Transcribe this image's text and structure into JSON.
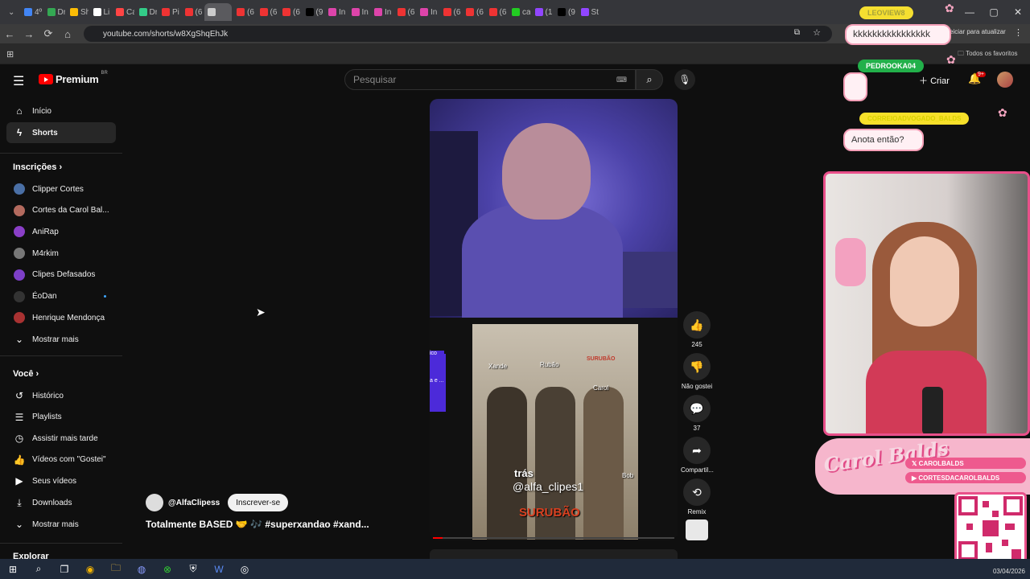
{
  "browser": {
    "tabs": [
      "4º",
      "Dr",
      "Sh",
      "Li",
      "Ca",
      "Dr",
      "Pi",
      "(6",
      "",
      "(6",
      "(6",
      "(6",
      "(9",
      "In",
      "In",
      "In",
      "(6",
      "In",
      "(6",
      "(6",
      "(6",
      "ca",
      "(1",
      "(9",
      "St"
    ],
    "url": "youtube.com/shorts/w8XgShqEhJk",
    "update_text": "eiciar para atualizar",
    "favorites_folder": "Todos os favoritos"
  },
  "youtube": {
    "logo": "Premium",
    "region": "BR",
    "search_placeholder": "Pesquisar",
    "create_label": "Criar",
    "notif_badge": "9+"
  },
  "sidebar": {
    "top": [
      {
        "label": "Início",
        "icon": "home-icon"
      },
      {
        "label": "Shorts",
        "icon": "shorts-icon",
        "selected": true
      }
    ],
    "subscriptions_title": "Inscrições",
    "subscriptions": [
      {
        "label": "Clipper Cortes",
        "color": "#4a6fa5"
      },
      {
        "label": "Cortes da Carol Bal...",
        "color": "#b36a5e"
      },
      {
        "label": "AniRap",
        "color": "#8a3fc7"
      },
      {
        "label": "M4rkim",
        "color": "#777777"
      },
      {
        "label": "Clipes Defasados",
        "color": "#7d3fc7"
      },
      {
        "label": "ÉoDan",
        "color": "#333333",
        "live": true
      },
      {
        "label": "Henrique Mendonça",
        "color": "#a83232"
      }
    ],
    "more_subs": "Mostrar mais",
    "you_title": "Você",
    "you_items": [
      {
        "label": "Histórico",
        "icon": "history-icon"
      },
      {
        "label": "Playlists",
        "icon": "playlists-icon"
      },
      {
        "label": "Assistir mais tarde",
        "icon": "clock-icon"
      },
      {
        "label": "Vídeos com \"Gostei\"",
        "icon": "like-icon"
      },
      {
        "label": "Seus vídeos",
        "icon": "video-icon"
      },
      {
        "label": "Downloads",
        "icon": "download-icon"
      }
    ],
    "more_you": "Mostrar mais",
    "explore_title": "Explorar"
  },
  "short": {
    "channel": "@AlfaClipess",
    "subscribe": "Inscrever-se",
    "title": "Totalmente BASED 🤝 🎶 #superxandao #xand...",
    "overlay_trash": "trás",
    "overlay_handle": "@alfa_clipes1",
    "overlay_logo": "SURUBÃO",
    "overlay_corner": "SURUBÃO",
    "names": [
      "Xande",
      "Rubão",
      "Carol",
      "Bob"
    ],
    "side_card_label": "ico",
    "side_card_text": "a e ...",
    "likes": "245",
    "dislike_label": "Não gostei",
    "comments": "37",
    "share_label": "Compartil...",
    "remix_label": "Remix",
    "progress_fraction": 0.04
  },
  "stream": {
    "chat": [
      {
        "user": "LEOVIEW8",
        "message": "kkkkkkkkkkkkkkkk"
      },
      {
        "user": "PEDROOKA04",
        "message": ""
      },
      {
        "user": "CORREIOADVOGADO_BALDS",
        "message": "Anota então?"
      }
    ],
    "streamer_name": "Carol Balds",
    "social_x": "CAROLBALDS",
    "social_yt": "CORTESDACAROLBALDS"
  },
  "taskbar": {
    "date": "03/04/2026"
  }
}
